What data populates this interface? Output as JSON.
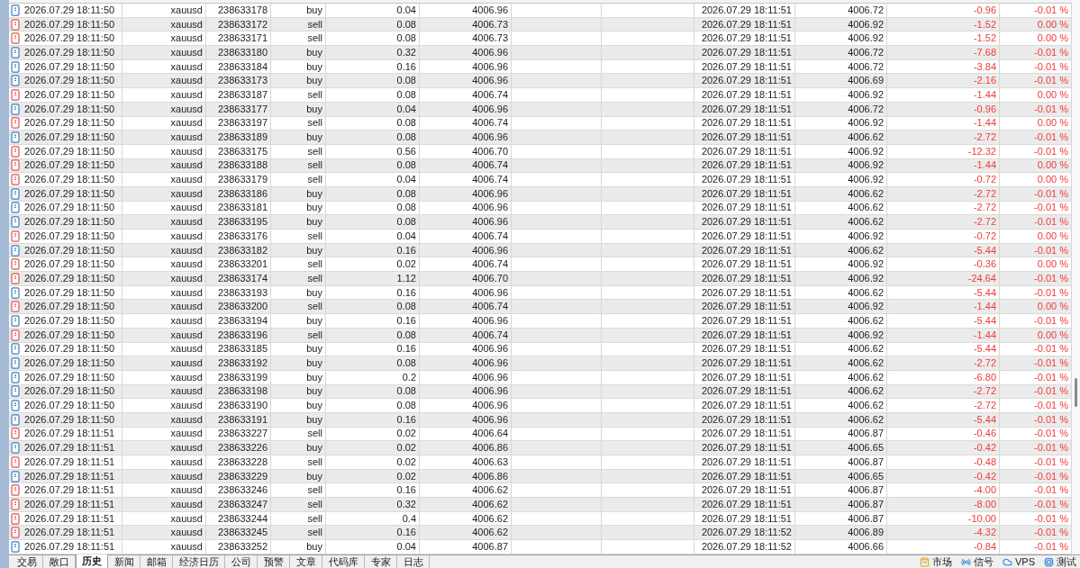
{
  "table": {
    "rows": [
      {
        "kind": "buy",
        "cells": [
          "2026.07.29 18:11:50",
          "xauusd",
          "238633178",
          "buy",
          "0.04",
          "4006.96",
          "2026.07.29 18:11:51",
          "4006.72",
          "-0.96",
          "-0.01 %"
        ]
      },
      {
        "kind": "sell",
        "cells": [
          "2026.07.29 18:11:50",
          "xauusd",
          "238633172",
          "sell",
          "0.08",
          "4006.73",
          "2026.07.29 18:11:51",
          "4006.92",
          "-1.52",
          "0.00 %"
        ]
      },
      {
        "kind": "sell",
        "cells": [
          "2026.07.29 18:11:50",
          "xauusd",
          "238633171",
          "sell",
          "0.08",
          "4006.73",
          "2026.07.29 18:11:51",
          "4006.92",
          "-1.52",
          "0.00 %"
        ]
      },
      {
        "kind": "buy",
        "cells": [
          "2026.07.29 18:11:50",
          "xauusd",
          "238633180",
          "buy",
          "0.32",
          "4006.96",
          "2026.07.29 18:11:51",
          "4006.72",
          "-7.68",
          "-0.01 %"
        ]
      },
      {
        "kind": "buy",
        "cells": [
          "2026.07.29 18:11:50",
          "xauusd",
          "238633184",
          "buy",
          "0.16",
          "4006.96",
          "2026.07.29 18:11:51",
          "4006.72",
          "-3.84",
          "-0.01 %"
        ]
      },
      {
        "kind": "buy",
        "cells": [
          "2026.07.29 18:11:50",
          "xauusd",
          "238633173",
          "buy",
          "0.08",
          "4006.96",
          "2026.07.29 18:11:51",
          "4006.69",
          "-2.16",
          "-0.01 %"
        ]
      },
      {
        "kind": "sell",
        "cells": [
          "2026.07.29 18:11:50",
          "xauusd",
          "238633187",
          "sell",
          "0.08",
          "4006.74",
          "2026.07.29 18:11:51",
          "4006.92",
          "-1.44",
          "0.00 %"
        ]
      },
      {
        "kind": "buy",
        "cells": [
          "2026.07.29 18:11:50",
          "xauusd",
          "238633177",
          "buy",
          "0.04",
          "4006.96",
          "2026.07.29 18:11:51",
          "4006.72",
          "-0.96",
          "-0.01 %"
        ]
      },
      {
        "kind": "sell",
        "cells": [
          "2026.07.29 18:11:50",
          "xauusd",
          "238633197",
          "sell",
          "0.08",
          "4006.74",
          "2026.07.29 18:11:51",
          "4006.92",
          "-1.44",
          "0.00 %"
        ]
      },
      {
        "kind": "buy",
        "cells": [
          "2026.07.29 18:11:50",
          "xauusd",
          "238633189",
          "buy",
          "0.08",
          "4006.96",
          "2026.07.29 18:11:51",
          "4006.62",
          "-2.72",
          "-0.01 %"
        ]
      },
      {
        "kind": "sell",
        "cells": [
          "2026.07.29 18:11:50",
          "xauusd",
          "238633175",
          "sell",
          "0.56",
          "4006.70",
          "2026.07.29 18:11:51",
          "4006.92",
          "-12.32",
          "-0.01 %"
        ]
      },
      {
        "kind": "sell",
        "cells": [
          "2026.07.29 18:11:50",
          "xauusd",
          "238633188",
          "sell",
          "0.08",
          "4006.74",
          "2026.07.29 18:11:51",
          "4006.92",
          "-1.44",
          "0.00 %"
        ]
      },
      {
        "kind": "sell",
        "cells": [
          "2026.07.29 18:11:50",
          "xauusd",
          "238633179",
          "sell",
          "0.04",
          "4006.74",
          "2026.07.29 18:11:51",
          "4006.92",
          "-0.72",
          "0.00 %"
        ]
      },
      {
        "kind": "buy",
        "cells": [
          "2026.07.29 18:11:50",
          "xauusd",
          "238633186",
          "buy",
          "0.08",
          "4006.96",
          "2026.07.29 18:11:51",
          "4006.62",
          "-2.72",
          "-0.01 %"
        ]
      },
      {
        "kind": "buy",
        "cells": [
          "2026.07.29 18:11:50",
          "xauusd",
          "238633181",
          "buy",
          "0.08",
          "4006.96",
          "2026.07.29 18:11:51",
          "4006.62",
          "-2.72",
          "-0.01 %"
        ]
      },
      {
        "kind": "buy",
        "cells": [
          "2026.07.29 18:11:50",
          "xauusd",
          "238633195",
          "buy",
          "0.08",
          "4006.96",
          "2026.07.29 18:11:51",
          "4006.62",
          "-2.72",
          "-0.01 %"
        ]
      },
      {
        "kind": "sell",
        "cells": [
          "2026.07.29 18:11:50",
          "xauusd",
          "238633176",
          "sell",
          "0.04",
          "4006.74",
          "2026.07.29 18:11:51",
          "4006.92",
          "-0.72",
          "0.00 %"
        ]
      },
      {
        "kind": "buy",
        "cells": [
          "2026.07.29 18:11:50",
          "xauusd",
          "238633182",
          "buy",
          "0.16",
          "4006.96",
          "2026.07.29 18:11:51",
          "4006.62",
          "-5.44",
          "-0.01 %"
        ]
      },
      {
        "kind": "sell",
        "cells": [
          "2026.07.29 18:11:50",
          "xauusd",
          "238633201",
          "sell",
          "0.02",
          "4006.74",
          "2026.07.29 18:11:51",
          "4006.92",
          "-0.36",
          "0.00 %"
        ]
      },
      {
        "kind": "sell",
        "cells": [
          "2026.07.29 18:11:50",
          "xauusd",
          "238633174",
          "sell",
          "1.12",
          "4006.70",
          "2026.07.29 18:11:51",
          "4006.92",
          "-24.64",
          "-0.01 %"
        ]
      },
      {
        "kind": "buy",
        "cells": [
          "2026.07.29 18:11:50",
          "xauusd",
          "238633193",
          "buy",
          "0.16",
          "4006.96",
          "2026.07.29 18:11:51",
          "4006.62",
          "-5.44",
          "-0.01 %"
        ]
      },
      {
        "kind": "sell",
        "cells": [
          "2026.07.29 18:11:50",
          "xauusd",
          "238633200",
          "sell",
          "0.08",
          "4006.74",
          "2026.07.29 18:11:51",
          "4006.92",
          "-1.44",
          "0.00 %"
        ]
      },
      {
        "kind": "buy",
        "cells": [
          "2026.07.29 18:11:50",
          "xauusd",
          "238633194",
          "buy",
          "0.16",
          "4006.96",
          "2026.07.29 18:11:51",
          "4006.62",
          "-5.44",
          "-0.01 %"
        ]
      },
      {
        "kind": "sell",
        "cells": [
          "2026.07.29 18:11:50",
          "xauusd",
          "238633196",
          "sell",
          "0.08",
          "4006.74",
          "2026.07.29 18:11:51",
          "4006.92",
          "-1.44",
          "0.00 %"
        ]
      },
      {
        "kind": "buy",
        "cells": [
          "2026.07.29 18:11:50",
          "xauusd",
          "238633185",
          "buy",
          "0.16",
          "4006.96",
          "2026.07.29 18:11:51",
          "4006.62",
          "-5.44",
          "-0.01 %"
        ]
      },
      {
        "kind": "buy",
        "cells": [
          "2026.07.29 18:11:50",
          "xauusd",
          "238633192",
          "buy",
          "0.08",
          "4006.96",
          "2026.07.29 18:11:51",
          "4006.62",
          "-2.72",
          "-0.01 %"
        ]
      },
      {
        "kind": "buy",
        "cells": [
          "2026.07.29 18:11:50",
          "xauusd",
          "238633199",
          "buy",
          "0.2",
          "4006.96",
          "2026.07.29 18:11:51",
          "4006.62",
          "-6.80",
          "-0.01 %"
        ]
      },
      {
        "kind": "buy",
        "cells": [
          "2026.07.29 18:11:50",
          "xauusd",
          "238633198",
          "buy",
          "0.08",
          "4006.96",
          "2026.07.29 18:11:51",
          "4006.62",
          "-2.72",
          "-0.01 %"
        ]
      },
      {
        "kind": "buy",
        "cells": [
          "2026.07.29 18:11:50",
          "xauusd",
          "238633190",
          "buy",
          "0.08",
          "4006.96",
          "2026.07.29 18:11:51",
          "4006.62",
          "-2.72",
          "-0.01 %"
        ]
      },
      {
        "kind": "buy",
        "cells": [
          "2026.07.29 18:11:50",
          "xauusd",
          "238633191",
          "buy",
          "0.16",
          "4006.96",
          "2026.07.29 18:11:51",
          "4006.62",
          "-5.44",
          "-0.01 %"
        ]
      },
      {
        "kind": "sell",
        "cells": [
          "2026.07.29 18:11:51",
          "xauusd",
          "238633227",
          "sell",
          "0.02",
          "4006.64",
          "2026.07.29 18:11:51",
          "4006.87",
          "-0.46",
          "-0.01 %"
        ]
      },
      {
        "kind": "buy",
        "cells": [
          "2026.07.29 18:11:51",
          "xauusd",
          "238633226",
          "buy",
          "0.02",
          "4006.86",
          "2026.07.29 18:11:51",
          "4006.65",
          "-0.42",
          "-0.01 %"
        ]
      },
      {
        "kind": "sell",
        "cells": [
          "2026.07.29 18:11:51",
          "xauusd",
          "238633228",
          "sell",
          "0.02",
          "4006.63",
          "2026.07.29 18:11:51",
          "4006.87",
          "-0.48",
          "-0.01 %"
        ]
      },
      {
        "kind": "buy",
        "cells": [
          "2026.07.29 18:11:51",
          "xauusd",
          "238633229",
          "buy",
          "0.02",
          "4006.86",
          "2026.07.29 18:11:51",
          "4006.65",
          "-0.42",
          "-0.01 %"
        ]
      },
      {
        "kind": "sell",
        "cells": [
          "2026.07.29 18:11:51",
          "xauusd",
          "238633246",
          "sell",
          "0.16",
          "4006.62",
          "2026.07.29 18:11:51",
          "4006.87",
          "-4.00",
          "-0.01 %"
        ]
      },
      {
        "kind": "sell",
        "cells": [
          "2026.07.29 18:11:51",
          "xauusd",
          "238633247",
          "sell",
          "0.32",
          "4006.62",
          "2026.07.29 18:11:51",
          "4006.87",
          "-8.00",
          "-0.01 %"
        ]
      },
      {
        "kind": "sell",
        "cells": [
          "2026.07.29 18:11:51",
          "xauusd",
          "238633244",
          "sell",
          "0.4",
          "4006.62",
          "2026.07.29 18:11:51",
          "4006.87",
          "-10.00",
          "-0.01 %"
        ]
      },
      {
        "kind": "sell",
        "cells": [
          "2026.07.29 18:11:51",
          "xauusd",
          "238633245",
          "sell",
          "0.16",
          "4006.62",
          "2026.07.29 18:11:52",
          "4006.89",
          "-4.32",
          "-0.01 %"
        ]
      },
      {
        "kind": "buy",
        "cells": [
          "2026.07.29 18:11:51",
          "xauusd",
          "238633252",
          "buy",
          "0.04",
          "4006.87",
          "2026.07.29 18:11:52",
          "4006.66",
          "-0.84",
          "-0.01 %"
        ]
      }
    ]
  },
  "tabs": [
    {
      "label": "交易",
      "selected": false
    },
    {
      "label": "敞口",
      "selected": false
    },
    {
      "label": "历史",
      "selected": true
    },
    {
      "label": "新闻",
      "selected": false
    },
    {
      "label": "邮箱",
      "selected": false
    },
    {
      "label": "经济日历",
      "selected": false
    },
    {
      "label": "公司",
      "selected": false
    },
    {
      "label": "预警",
      "selected": false
    },
    {
      "label": "文章",
      "selected": false
    },
    {
      "label": "代码库",
      "selected": false
    },
    {
      "label": "专家",
      "selected": false
    },
    {
      "label": "日志",
      "selected": false
    }
  ],
  "status_items": [
    {
      "kind": "market",
      "label": "市场"
    },
    {
      "kind": "signals",
      "label": "信号"
    },
    {
      "kind": "vps",
      "label": "VPS"
    },
    {
      "kind": "tester",
      "label": "测试"
    }
  ]
}
